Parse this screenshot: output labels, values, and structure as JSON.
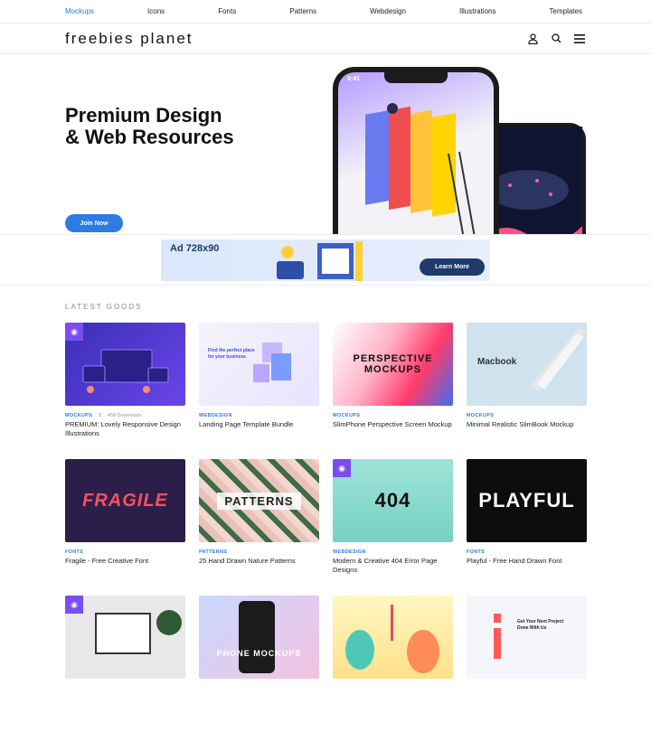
{
  "topnav": {
    "items": [
      {
        "label": "Mockups"
      },
      {
        "label": "Icons"
      },
      {
        "label": "Fonts"
      },
      {
        "label": "Patterns"
      },
      {
        "label": "Webdesign"
      },
      {
        "label": "Illustrations"
      },
      {
        "label": "Templates"
      }
    ]
  },
  "header": {
    "logo": "freebies planet",
    "icons": [
      "user-icon",
      "search-icon",
      "menu-icon"
    ]
  },
  "hero": {
    "title_line1": "Premium Design",
    "title_line2": "& Web Resources",
    "cta": "Join Now",
    "phone_time": "9:41"
  },
  "ad": {
    "label": "Ad 728x90",
    "button": "Learn More"
  },
  "latest": {
    "title": "LATEST GOODS",
    "items": [
      {
        "category": "MOCKUPS",
        "downloads": "458 Downloads",
        "title": "PREMIUM: Lovely Responsive Design Illustrations",
        "locked": true,
        "thumb_text": ""
      },
      {
        "category": "WEBDESIGN",
        "downloads": "",
        "title": "Landing Page Template Bundle",
        "locked": false,
        "thumb_text": "Find the perfect place for your business"
      },
      {
        "category": "MOCKUPS",
        "downloads": "",
        "title": "SlimPhone Perspective Screen Mockup",
        "locked": false,
        "thumb_text": "PERSPECTIVE MOCKUPS"
      },
      {
        "category": "MOCKUPS",
        "downloads": "",
        "title": "Minimal Realistic SlimBook Mockup",
        "locked": false,
        "thumb_text": "Macbook"
      },
      {
        "category": "FONTS",
        "downloads": "",
        "title": "Fragile - Free Creative Font",
        "locked": false,
        "thumb_text": "FRAGILE"
      },
      {
        "category": "PATTERNS",
        "downloads": "",
        "title": "25 Hand Drawn Nature Patterns",
        "locked": false,
        "thumb_text": "PATTERNS"
      },
      {
        "category": "WEBDESIGN",
        "downloads": "",
        "title": "Modern & Creative 404 Error Page Designs",
        "locked": true,
        "thumb_text": "404"
      },
      {
        "category": "FONTS",
        "downloads": "",
        "title": "Playful - Free Hand Drawn Font",
        "locked": false,
        "thumb_text": "PLAYFUL"
      },
      {
        "category": "",
        "downloads": "",
        "title": "",
        "locked": true,
        "thumb_text": ""
      },
      {
        "category": "",
        "downloads": "",
        "title": "",
        "locked": false,
        "thumb_text": "PHONE MOCKUPS"
      },
      {
        "category": "",
        "downloads": "",
        "title": "",
        "locked": false,
        "thumb_text": ""
      },
      {
        "category": "",
        "downloads": "",
        "title": "",
        "locked": false,
        "thumb_text": "Get Your Next Project Done With Us"
      }
    ]
  },
  "colors": {
    "accent": "#2d7be5",
    "lock": "#7b4df0"
  }
}
